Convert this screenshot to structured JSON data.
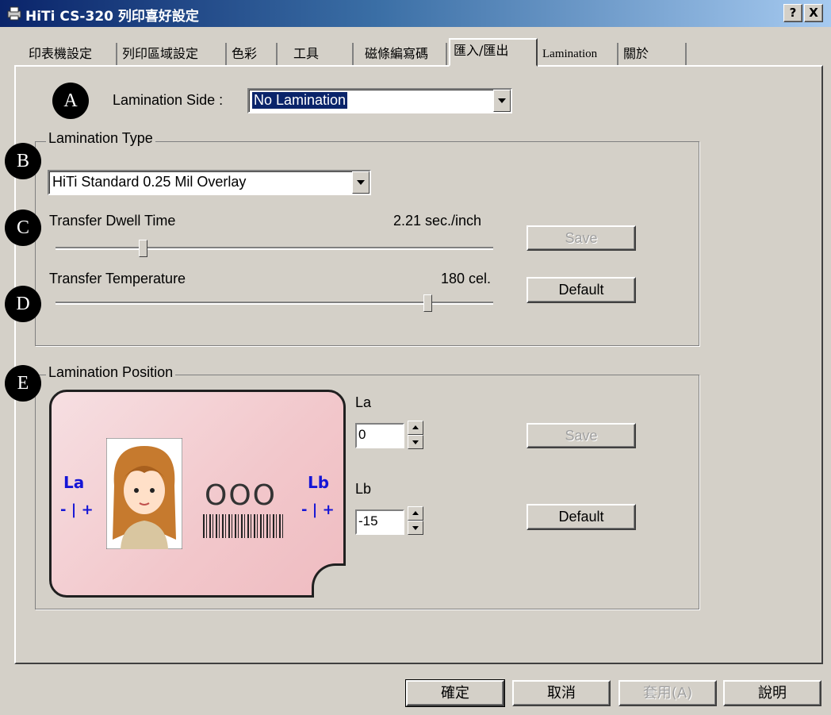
{
  "window": {
    "title": "HiTi CS-320 列印喜好設定",
    "help_btn": "?",
    "close_btn": "X"
  },
  "tabs": [
    {
      "label": "印表機設定"
    },
    {
      "label": "列印區域設定"
    },
    {
      "label": "色彩"
    },
    {
      "label": "工具"
    },
    {
      "label": "磁條編寫碼"
    },
    {
      "label": "匯入/匯出"
    },
    {
      "label": "Lamination"
    },
    {
      "label": "關於"
    }
  ],
  "badges": [
    "A",
    "B",
    "C",
    "D",
    "E"
  ],
  "lamination_side": {
    "label": "Lamination Side :",
    "value": "No Lamination"
  },
  "lamination_type": {
    "legend": "Lamination Type",
    "select_value": "HiTi Standard 0.25 Mil Overlay",
    "dwell": {
      "label": "Transfer Dwell Time",
      "value_text": "2.21 sec./inch",
      "level": 0.2
    },
    "temperature": {
      "label": "Transfer Temperature",
      "value_text": "180 cel.",
      "level": 0.85
    },
    "save_label": "Save",
    "default_label": "Default"
  },
  "lamination_position": {
    "legend": "Lamination Position",
    "card": {
      "la_label": "La",
      "lb_label": "Lb",
      "minus_plus": "- | +",
      "circles": "OOO"
    },
    "la": {
      "label": "La",
      "value": "0"
    },
    "lb": {
      "label": "Lb",
      "value": "-15"
    },
    "save_label": "Save",
    "default_label": "Default"
  },
  "footer": {
    "ok": "確定",
    "cancel": "取消",
    "apply": "套用(A)",
    "help": "說明"
  }
}
